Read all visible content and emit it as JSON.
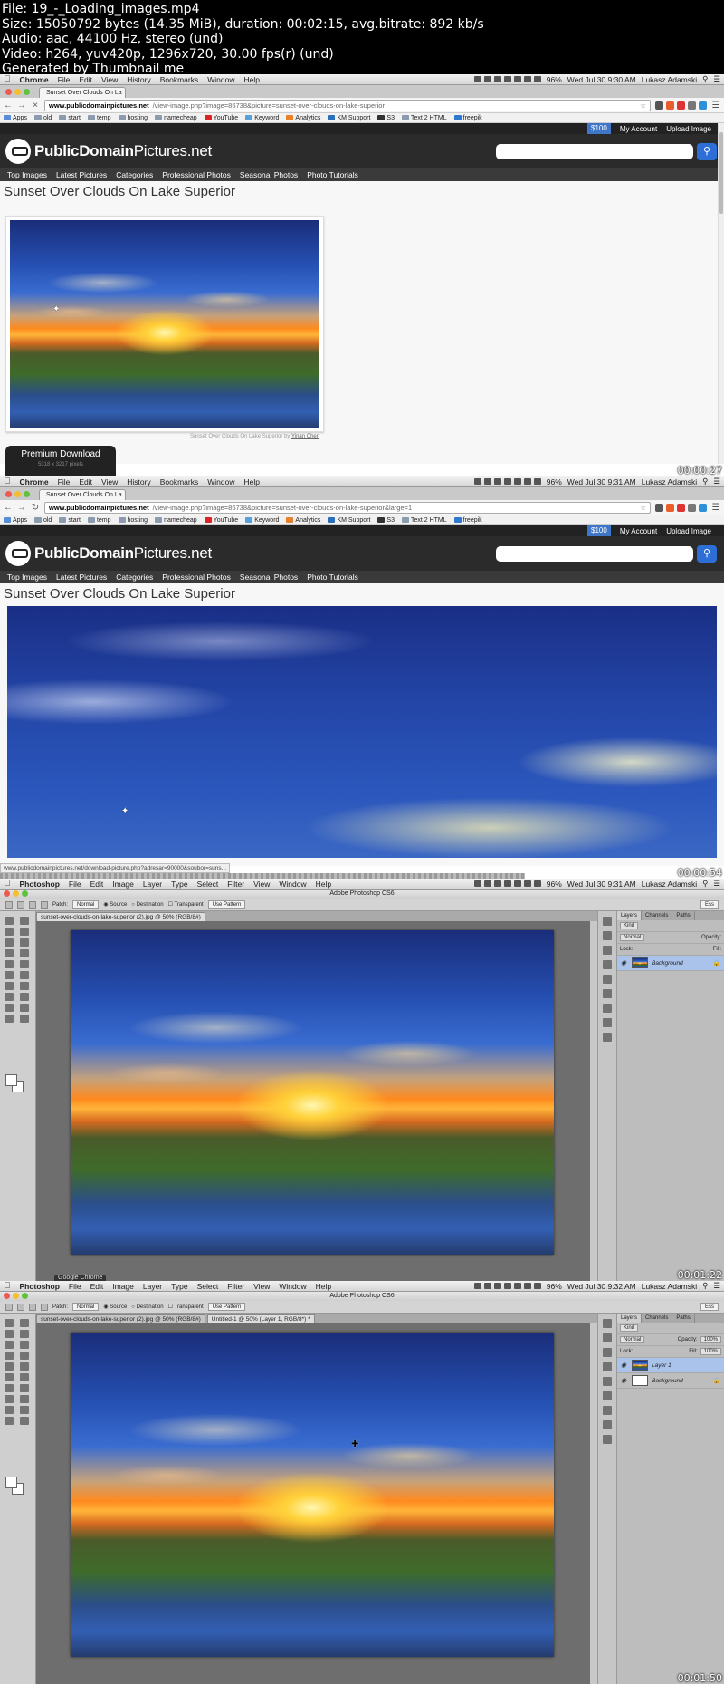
{
  "meta": {
    "lines": [
      "File: 19_-_Loading_images.mp4",
      "Size: 15050792 bytes (14.35 MiB), duration: 00:02:15, avg.bitrate: 892 kb/s",
      "Audio: aac, 44100 Hz, stereo (und)",
      "Video: h264, yuv420p, 1296x720, 30.00 fps(r) (und)",
      "Generated by Thumbnail me"
    ]
  },
  "macbar": {
    "chrome_menus": [
      "File",
      "Edit",
      "View",
      "History",
      "Bookmarks",
      "Window",
      "Help"
    ],
    "chrome_app": "Chrome",
    "ps_app": "Photoshop",
    "ps_menus": [
      "File",
      "Edit",
      "Image",
      "Layer",
      "Type",
      "Select",
      "Filter",
      "View",
      "Window",
      "Help"
    ],
    "battery": "96%",
    "user": "Lukasz Adamski",
    "times": [
      "Wed Jul 30  9:30 AM",
      "Wed Jul 30  9:31 AM",
      "Wed Jul 30  9:31 AM",
      "Wed Jul 30  9:32 AM"
    ]
  },
  "browser": {
    "tab_title": "Sunset Over Clouds On La",
    "url_domain": "www.publicdomainpictures.net",
    "url_path_1": "/view-image.php?image=86738&picture=sunset-over-clouds-on-lake-superior",
    "url_path_2": "/view-image.php?image=86738&picture=sunset-over-clouds-on-lake-superior&large=1",
    "bookmarks": [
      "Apps",
      "old",
      "start",
      "temp",
      "hosting",
      "namecheap",
      "YouTube",
      "Keyword",
      "Analytics",
      "KM Support",
      "S3",
      "Text 2 HTML",
      "freepik"
    ],
    "status_url": "www.publicdomainpictures.net/download-picture.php?adresar=90000&soubor=suns..."
  },
  "site": {
    "badge": "$100",
    "my_account": "My Account",
    "upload": "Upload Image",
    "logo_bold": "PublicDomain",
    "logo_rest": "Pictures.net",
    "nav": [
      "Top Images",
      "Latest Pictures",
      "Categories",
      "Professional Photos",
      "Seasonal Photos",
      "Photo Tutorials"
    ],
    "title": "Sunset Over Clouds On Lake Superior",
    "caption": "Sunset Over Clouds On Lake Superior by",
    "caption_author": "Yinan Chen",
    "premium_label": "Premium Download",
    "premium_sub": "5318 x 3217 pixels"
  },
  "photoshop": {
    "window_title": "Adobe Photoshop CS6",
    "patch_label": "Patch:",
    "patch_value": "Normal",
    "source": "Source",
    "destination": "Destination",
    "transparent": "Transparent",
    "use_pattern": "Use Pattern",
    "workspace": "Ess",
    "doc_tab_1": "sunset-over-clouds-on-lake-superior (2).jpg @ 50% (RGB/8#)",
    "doc_tab_2": "Untitled-1 @ 50% (Layer 1, RGB/8*) *",
    "panel_tabs": [
      "Layers",
      "Channels",
      "Paths"
    ],
    "kind": "Kind",
    "blend": "Normal",
    "opacity_label": "Opacity:",
    "opacity_value": "100%",
    "lock_label": "Lock:",
    "fill_label": "Fill:",
    "fill_value": "100%",
    "layer_background": "Background",
    "layer_1": "Layer 1",
    "dock_label": "Google Chrome"
  },
  "timestamps": [
    "00:00:27",
    "00:00:54",
    "00:01:22",
    "00:01:50"
  ]
}
